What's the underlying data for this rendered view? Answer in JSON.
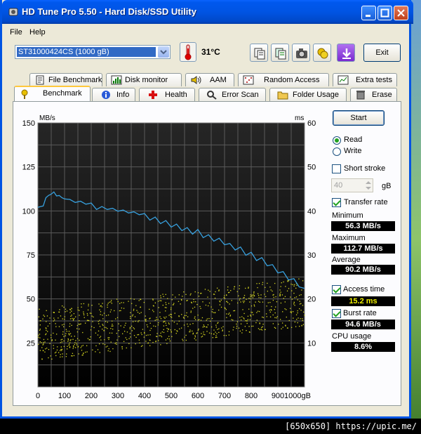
{
  "window": {
    "title": "HD Tune Pro 5.50 - Hard Disk/SSD Utility"
  },
  "menu": [
    "File",
    "Help"
  ],
  "toolbar": {
    "drive": "ST31000424CS (1000 gB)",
    "temperature": "31°C",
    "exit_label": "Exit",
    "icons": [
      "copy-icon",
      "copy-text-icon",
      "camera-icon",
      "coins-icon",
      "download-icon"
    ]
  },
  "tabs_top": [
    {
      "label": "File Benchmark",
      "icon": "file-benchmark-icon"
    },
    {
      "label": "Disk monitor",
      "icon": "disk-monitor-icon"
    },
    {
      "label": "AAM",
      "icon": "speaker-icon"
    },
    {
      "label": "Random Access",
      "icon": "random-access-icon"
    },
    {
      "label": "Extra tests",
      "icon": "extra-tests-icon"
    }
  ],
  "tabs_bottom": [
    {
      "label": "Benchmark",
      "icon": "benchmark-icon",
      "active": true
    },
    {
      "label": "Info",
      "icon": "info-icon"
    },
    {
      "label": "Health",
      "icon": "health-icon"
    },
    {
      "label": "Error Scan",
      "icon": "error-scan-icon"
    },
    {
      "label": "Folder Usage",
      "icon": "folder-icon"
    },
    {
      "label": "Erase",
      "icon": "erase-icon"
    }
  ],
  "side": {
    "start_label": "Start",
    "read_label": "Read",
    "write_label": "Write",
    "mode": "read",
    "short_stroke_label": "Short stroke",
    "short_stroke_checked": false,
    "short_stroke_value": "40",
    "short_stroke_unit": "gB",
    "transfer_rate_label": "Transfer rate",
    "transfer_rate_checked": true,
    "minimum_label": "Minimum",
    "minimum_value": "56.3 MB/s",
    "maximum_label": "Maximum",
    "maximum_value": "112.7 MB/s",
    "average_label": "Average",
    "average_value": "90.2 MB/s",
    "access_time_label": "Access time",
    "access_time_checked": true,
    "access_time_value": "15.2 ms",
    "burst_rate_label": "Burst rate",
    "burst_rate_checked": true,
    "burst_rate_value": "94.6 MB/s",
    "cpu_usage_label": "CPU usage",
    "cpu_usage_value": "8.6%"
  },
  "chart_data": {
    "type": "line",
    "ylabel": "MB/s",
    "y2label": "ms",
    "ylim": [
      0,
      150
    ],
    "y2lim": [
      0,
      60
    ],
    "xlim": [
      0,
      1000
    ],
    "x_ticks": [
      "0",
      "100",
      "200",
      "300",
      "400",
      "500",
      "600",
      "700",
      "800",
      "900",
      "1000gB"
    ],
    "y_ticks": [
      "25",
      "50",
      "75",
      "100",
      "125",
      "150"
    ],
    "y2_ticks": [
      "10",
      "20",
      "30",
      "40",
      "50",
      "60"
    ],
    "grid": true,
    "colors": {
      "background": "#000000",
      "grid": "#5a5a5a",
      "transfer": "#37a0de",
      "access": "#d8d820"
    },
    "series": [
      {
        "name": "Transfer rate",
        "x": [
          0,
          10,
          20,
          30,
          40,
          50,
          60,
          70,
          80,
          90,
          100,
          120,
          140,
          160,
          180,
          200,
          220,
          240,
          260,
          280,
          300,
          320,
          340,
          360,
          380,
          400,
          420,
          440,
          460,
          480,
          500,
          520,
          540,
          560,
          580,
          600,
          620,
          640,
          660,
          680,
          700,
          720,
          740,
          760,
          780,
          800,
          820,
          840,
          860,
          880,
          900,
          920,
          940,
          960,
          980,
          1000
        ],
        "values": [
          102,
          101,
          104,
          106,
          110,
          108,
          112,
          107,
          110,
          106,
          108,
          105,
          106,
          104,
          105,
          103,
          102,
          101,
          102,
          100,
          101,
          99,
          100,
          98,
          99,
          97,
          96,
          95,
          94,
          93,
          92,
          91,
          90,
          89,
          88,
          88,
          86,
          85,
          84,
          83,
          82,
          80,
          79,
          78,
          76,
          75,
          73,
          72,
          70,
          68,
          66,
          64,
          62,
          60,
          58,
          56
        ]
      }
    ],
    "access_time_ms_band": {
      "x_start": 0,
      "x_end": 1000,
      "low_start": 6,
      "high_start": 18,
      "low_end": 14,
      "high_end": 25
    }
  },
  "footer": "[650x650] https://upic.me/"
}
